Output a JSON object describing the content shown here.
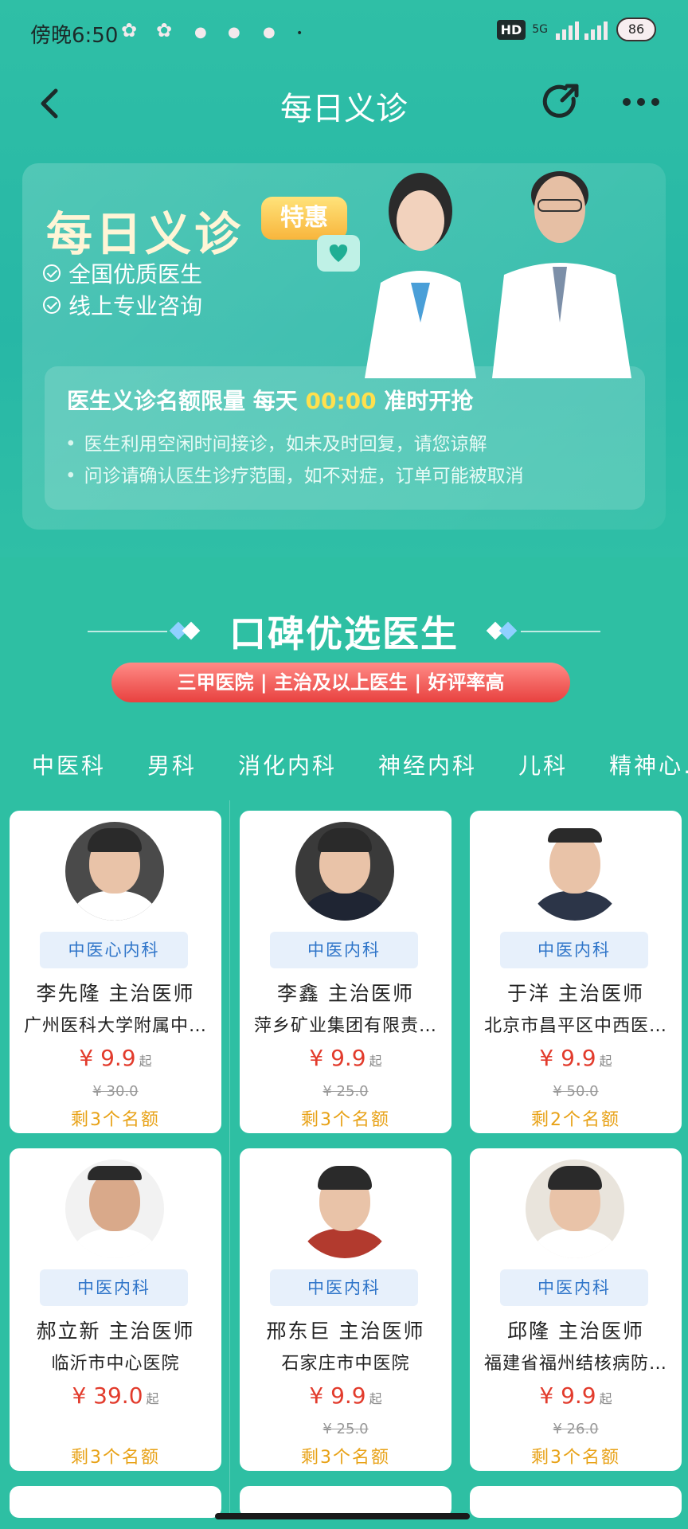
{
  "status_bar": {
    "time": "傍晚6:50",
    "hd": "HD",
    "signal": "5G",
    "battery": "86"
  },
  "nav": {
    "title": "每日义诊"
  },
  "banner": {
    "title": "每日义诊",
    "tag": "特惠",
    "features": [
      "全国优质医生",
      "线上专业咨询"
    ],
    "notice_prefix": "医生义诊名额限量 每天 ",
    "notice_time": "00:00",
    "notice_suffix": " 准时开抢",
    "notes": [
      "医生利用空闲时间接诊，如未及时回复，请您谅解",
      "问诊请确认医生诊疗范围，如不对症，订单可能被取消"
    ]
  },
  "section": {
    "title": "口碑优选医生",
    "pill": "三甲医院 | 主治及以上医生 | 好评率高"
  },
  "tabs": [
    "中医科",
    "男科",
    "消化内科",
    "神经内科",
    "儿科",
    "精神心…"
  ],
  "active_tab": 0,
  "doctors": [
    {
      "name": "李先隆  主治医师",
      "dept": "中医心内科",
      "hospital": "广州医科大学附属中…",
      "price": "¥ 9.9",
      "qi": "起",
      "original": "¥ 30.0",
      "quota": "剩3个名额"
    },
    {
      "name": "李鑫  主治医师",
      "dept": "中医内科",
      "hospital": "萍乡矿业集团有限责…",
      "price": "¥ 9.9",
      "qi": "起",
      "original": "¥ 25.0",
      "quota": "剩3个名额"
    },
    {
      "name": "于洋  主治医师",
      "dept": "中医内科",
      "hospital": "北京市昌平区中西医…",
      "price": "¥ 9.9",
      "qi": "起",
      "original": "¥ 50.0",
      "quota": "剩2个名额"
    },
    {
      "name": "郝立新  主治医师",
      "dept": "中医内科",
      "hospital": "临沂市中心医院",
      "price": "¥ 39.0",
      "qi": "起",
      "original": "",
      "quota": "剩3个名额"
    },
    {
      "name": "邢东巨  主治医师",
      "dept": "中医内科",
      "hospital": "石家庄市中医院",
      "price": "¥ 9.9",
      "qi": "起",
      "original": "¥ 25.0",
      "quota": "剩3个名额"
    },
    {
      "name": "邱隆  主治医师",
      "dept": "中医内科",
      "hospital": "福建省福州结核病防…",
      "price": "¥ 9.9",
      "qi": "起",
      "original": "¥ 26.0",
      "quota": "剩3个名额"
    }
  ],
  "colors": {
    "background": "#2ebfa3",
    "price": "#e23b2c",
    "quota": "#e8a217",
    "dept_tag": "#2f75c9"
  }
}
